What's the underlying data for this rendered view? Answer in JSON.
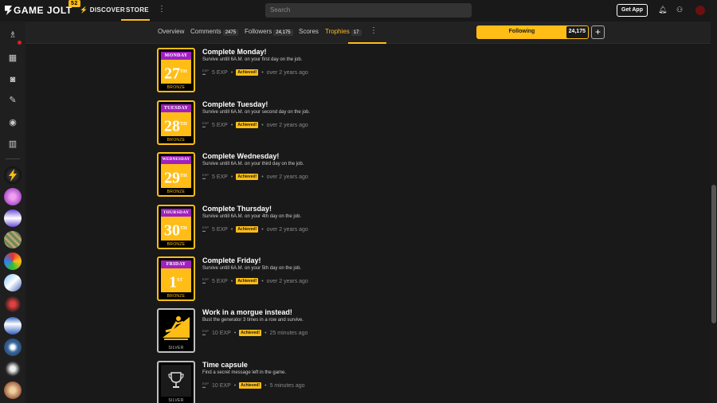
{
  "topbar": {
    "logo_text": "GAME JOLT",
    "logo_badge": "52",
    "discover_label": "DISCOVER",
    "store_label": "STORE",
    "search_placeholder": "Search",
    "get_app_label": "Get App"
  },
  "subnav": {
    "tabs": [
      {
        "label": "Overview"
      },
      {
        "label": "Comments",
        "count": "2475"
      },
      {
        "label": "Followers",
        "count": "24,175"
      },
      {
        "label": "Scores"
      },
      {
        "label": "Trophies",
        "count": "17"
      }
    ],
    "active_tab": "Trophies",
    "follow_label": "Following",
    "follow_count": "24,175",
    "plus_label": "+"
  },
  "trophies": [
    {
      "title": "Complete Monday!",
      "desc": "Survive untill 6A.M. on your first day on the job.",
      "exp": "5 EXP",
      "status": "Achieved!",
      "time": "over 2 years ago",
      "tier": "BRONZE",
      "img_day": "MONDAY",
      "img_num": "27",
      "img_sup": "TH"
    },
    {
      "title": "Complete Tuesday!",
      "desc": "Survive untill 6A.M. on your second day on the job.",
      "exp": "5 EXP",
      "status": "Achieved!",
      "time": "over 2 years ago",
      "tier": "BRONZE",
      "img_day": "TUESDAY",
      "img_num": "28",
      "img_sup": "TH"
    },
    {
      "title": "Complete Wednesday!",
      "desc": "Survive untill 6A.M. on your third day on the job.",
      "exp": "5 EXP",
      "status": "Achieved!",
      "time": "over 2 years ago",
      "tier": "BRONZE",
      "img_day": "WEDNESDAY",
      "img_num": "29",
      "img_sup": "TH"
    },
    {
      "title": "Complete Thursday!",
      "desc": "Survive untill 6A.M. on your 4th day on the job.",
      "exp": "5 EXP",
      "status": "Achieved!",
      "time": "over 2 years ago",
      "tier": "BRONZE",
      "img_day": "THURSDAY",
      "img_num": "30",
      "img_sup": "TH"
    },
    {
      "title": "Complete Friday!",
      "desc": "Survive untill 6A.M. on your 5th day on the job.",
      "exp": "5 EXP",
      "status": "Achieved!",
      "time": "over 2 years ago",
      "tier": "BRONZE",
      "img_day": "FRIDAY",
      "img_num": "1",
      "img_sup": "ST"
    },
    {
      "title": "Work in a morgue instead!",
      "desc": "Bust the generator 3 times in a row and survive.",
      "exp": "10 EXP",
      "status": "Achieved!",
      "time": "25 minutes ago",
      "tier": "SILVER"
    },
    {
      "title": "Time capsule",
      "desc": "Find a secret message left in the game.",
      "exp": "10 EXP",
      "status": "Achieved!",
      "time": "5 minutes ago",
      "tier": "SILVER"
    }
  ],
  "colors": {
    "accent": "#ffbd16",
    "background": "#191919",
    "calendar_header": "#a020c0"
  }
}
